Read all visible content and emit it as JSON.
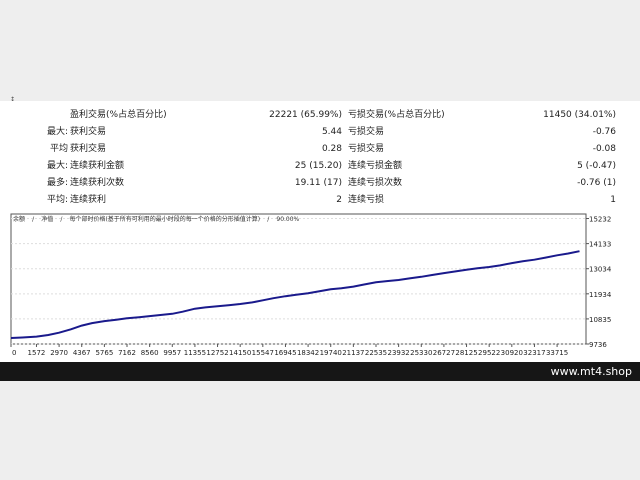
{
  "corner_mark": "↕",
  "stats": [
    {
      "label": "",
      "title1": "盈利交易(%占总百分比)",
      "value1": "22221 (65.99%)",
      "title2": "亏损交易(%占总百分比)",
      "value2": "11450 (34.01%)"
    },
    {
      "label": "最大:",
      "title1": "获利交易",
      "value1": "5.44",
      "title2": "亏损交易",
      "value2": "-0.76"
    },
    {
      "label": "平均",
      "title1": "获利交易",
      "value1": "0.28",
      "title2": "亏损交易",
      "value2": "-0.08"
    },
    {
      "label": "最大:",
      "title1": "连续获利金额",
      "value1": "25 (15.20)",
      "title2": "连续亏损金额",
      "value2": "5 (-0.47)"
    },
    {
      "label": "最多:",
      "title1": "连续获利次数",
      "value1": "19.11 (17)",
      "title2": "连续亏损次数",
      "value2": "-0.76 (1)"
    },
    {
      "label": "平均:",
      "title1": "连续获利",
      "value1": "2",
      "title2": "连续亏损",
      "value2": "1"
    }
  ],
  "chart_data": {
    "type": "line",
    "legend": {
      "balance": "余额",
      "sep1": "/",
      "equity": "净值",
      "sep2": "/",
      "lots": "每个部时价格(基于所有可利用的最小时段的每一个价格的分形插值计算)",
      "sep3": "/",
      "quality": "90.00%"
    },
    "x_ticks": [
      0,
      1572,
      2970,
      4367,
      5765,
      7162,
      8560,
      9957,
      11355,
      12752,
      14150,
      15547,
      16945,
      18342,
      19740,
      21137,
      22535,
      23932,
      25330,
      26727,
      28125,
      29522,
      30920,
      32317,
      33715
    ],
    "y_ticks": [
      9736,
      10835,
      11934,
      13034,
      14133,
      15232
    ],
    "xlim": [
      0,
      35500
    ],
    "ylim": [
      9736,
      15430
    ],
    "series": [
      {
        "color": "#1a1a8c",
        "x": [
          0,
          700,
          1572,
          2300,
          2970,
          3700,
          4367,
          5000,
          5765,
          6500,
          7162,
          7900,
          8560,
          9300,
          9957,
          10600,
          11355,
          12000,
          12752,
          13500,
          14150,
          14900,
          15547,
          16200,
          16945,
          17600,
          18342,
          19000,
          19740,
          20400,
          21137,
          21800,
          22535,
          23200,
          23932,
          24600,
          25330,
          26000,
          26727,
          27400,
          28125,
          28800,
          29522,
          30200,
          30920,
          31600,
          32317,
          33000,
          33715,
          34400,
          35100
        ],
        "values": [
          10000,
          10020,
          10060,
          10130,
          10230,
          10380,
          10540,
          10650,
          10740,
          10800,
          10860,
          10910,
          10960,
          11010,
          11060,
          11150,
          11280,
          11340,
          11390,
          11440,
          11490,
          11560,
          11650,
          11740,
          11830,
          11890,
          11960,
          12040,
          12130,
          12180,
          12250,
          12340,
          12440,
          12490,
          12540,
          12610,
          12680,
          12760,
          12840,
          12910,
          12990,
          13050,
          13110,
          13180,
          13280,
          13360,
          13430,
          13520,
          13620,
          13700,
          13800
        ]
      }
    ]
  },
  "footer": {
    "brand": "www.mt4.shop"
  }
}
